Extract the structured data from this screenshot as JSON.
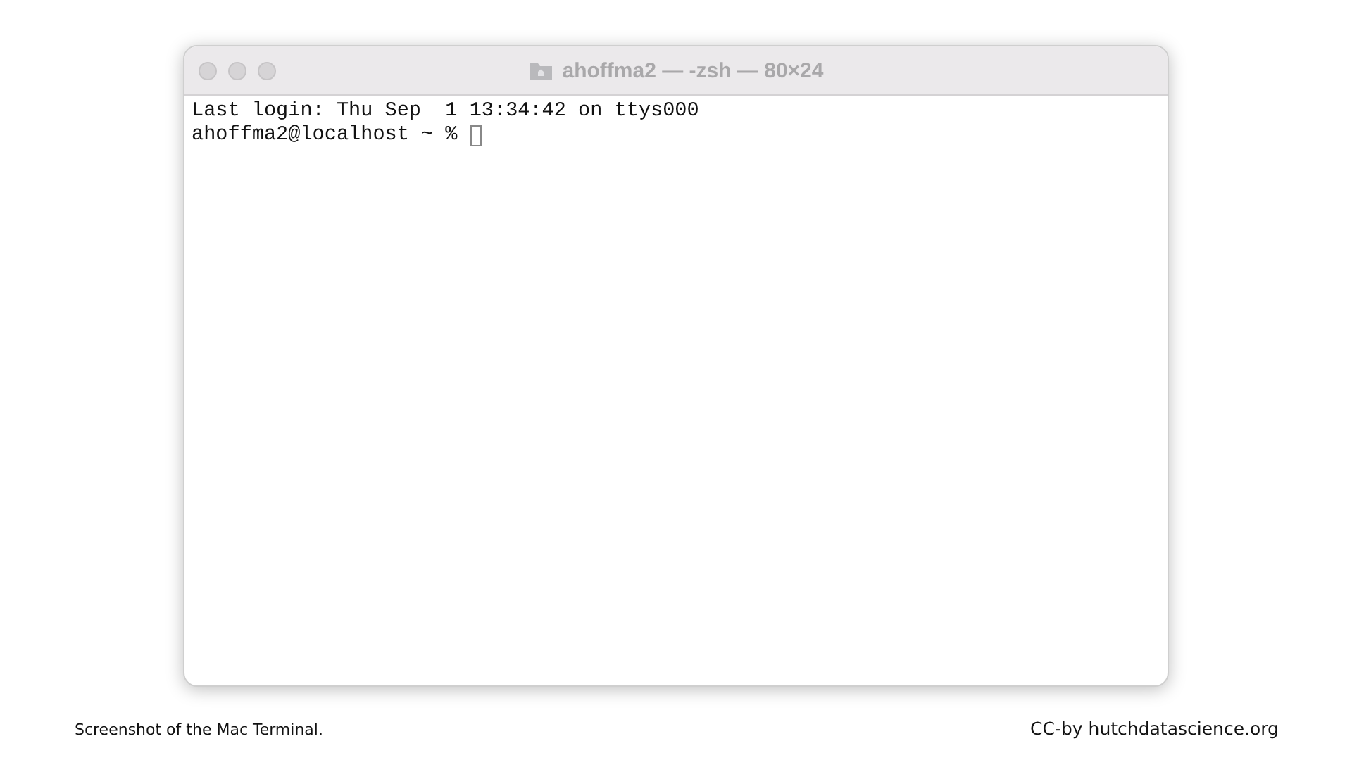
{
  "window": {
    "title": "ahoffma2 — -zsh — 80×24"
  },
  "terminal": {
    "lines": [
      "Last login: Thu Sep  1 13:34:42 on ttys000"
    ],
    "prompt": "ahoffma2@localhost ~ %"
  },
  "caption": "Screenshot of the Mac Terminal.",
  "credit": "CC-by hutchdatascience.org"
}
